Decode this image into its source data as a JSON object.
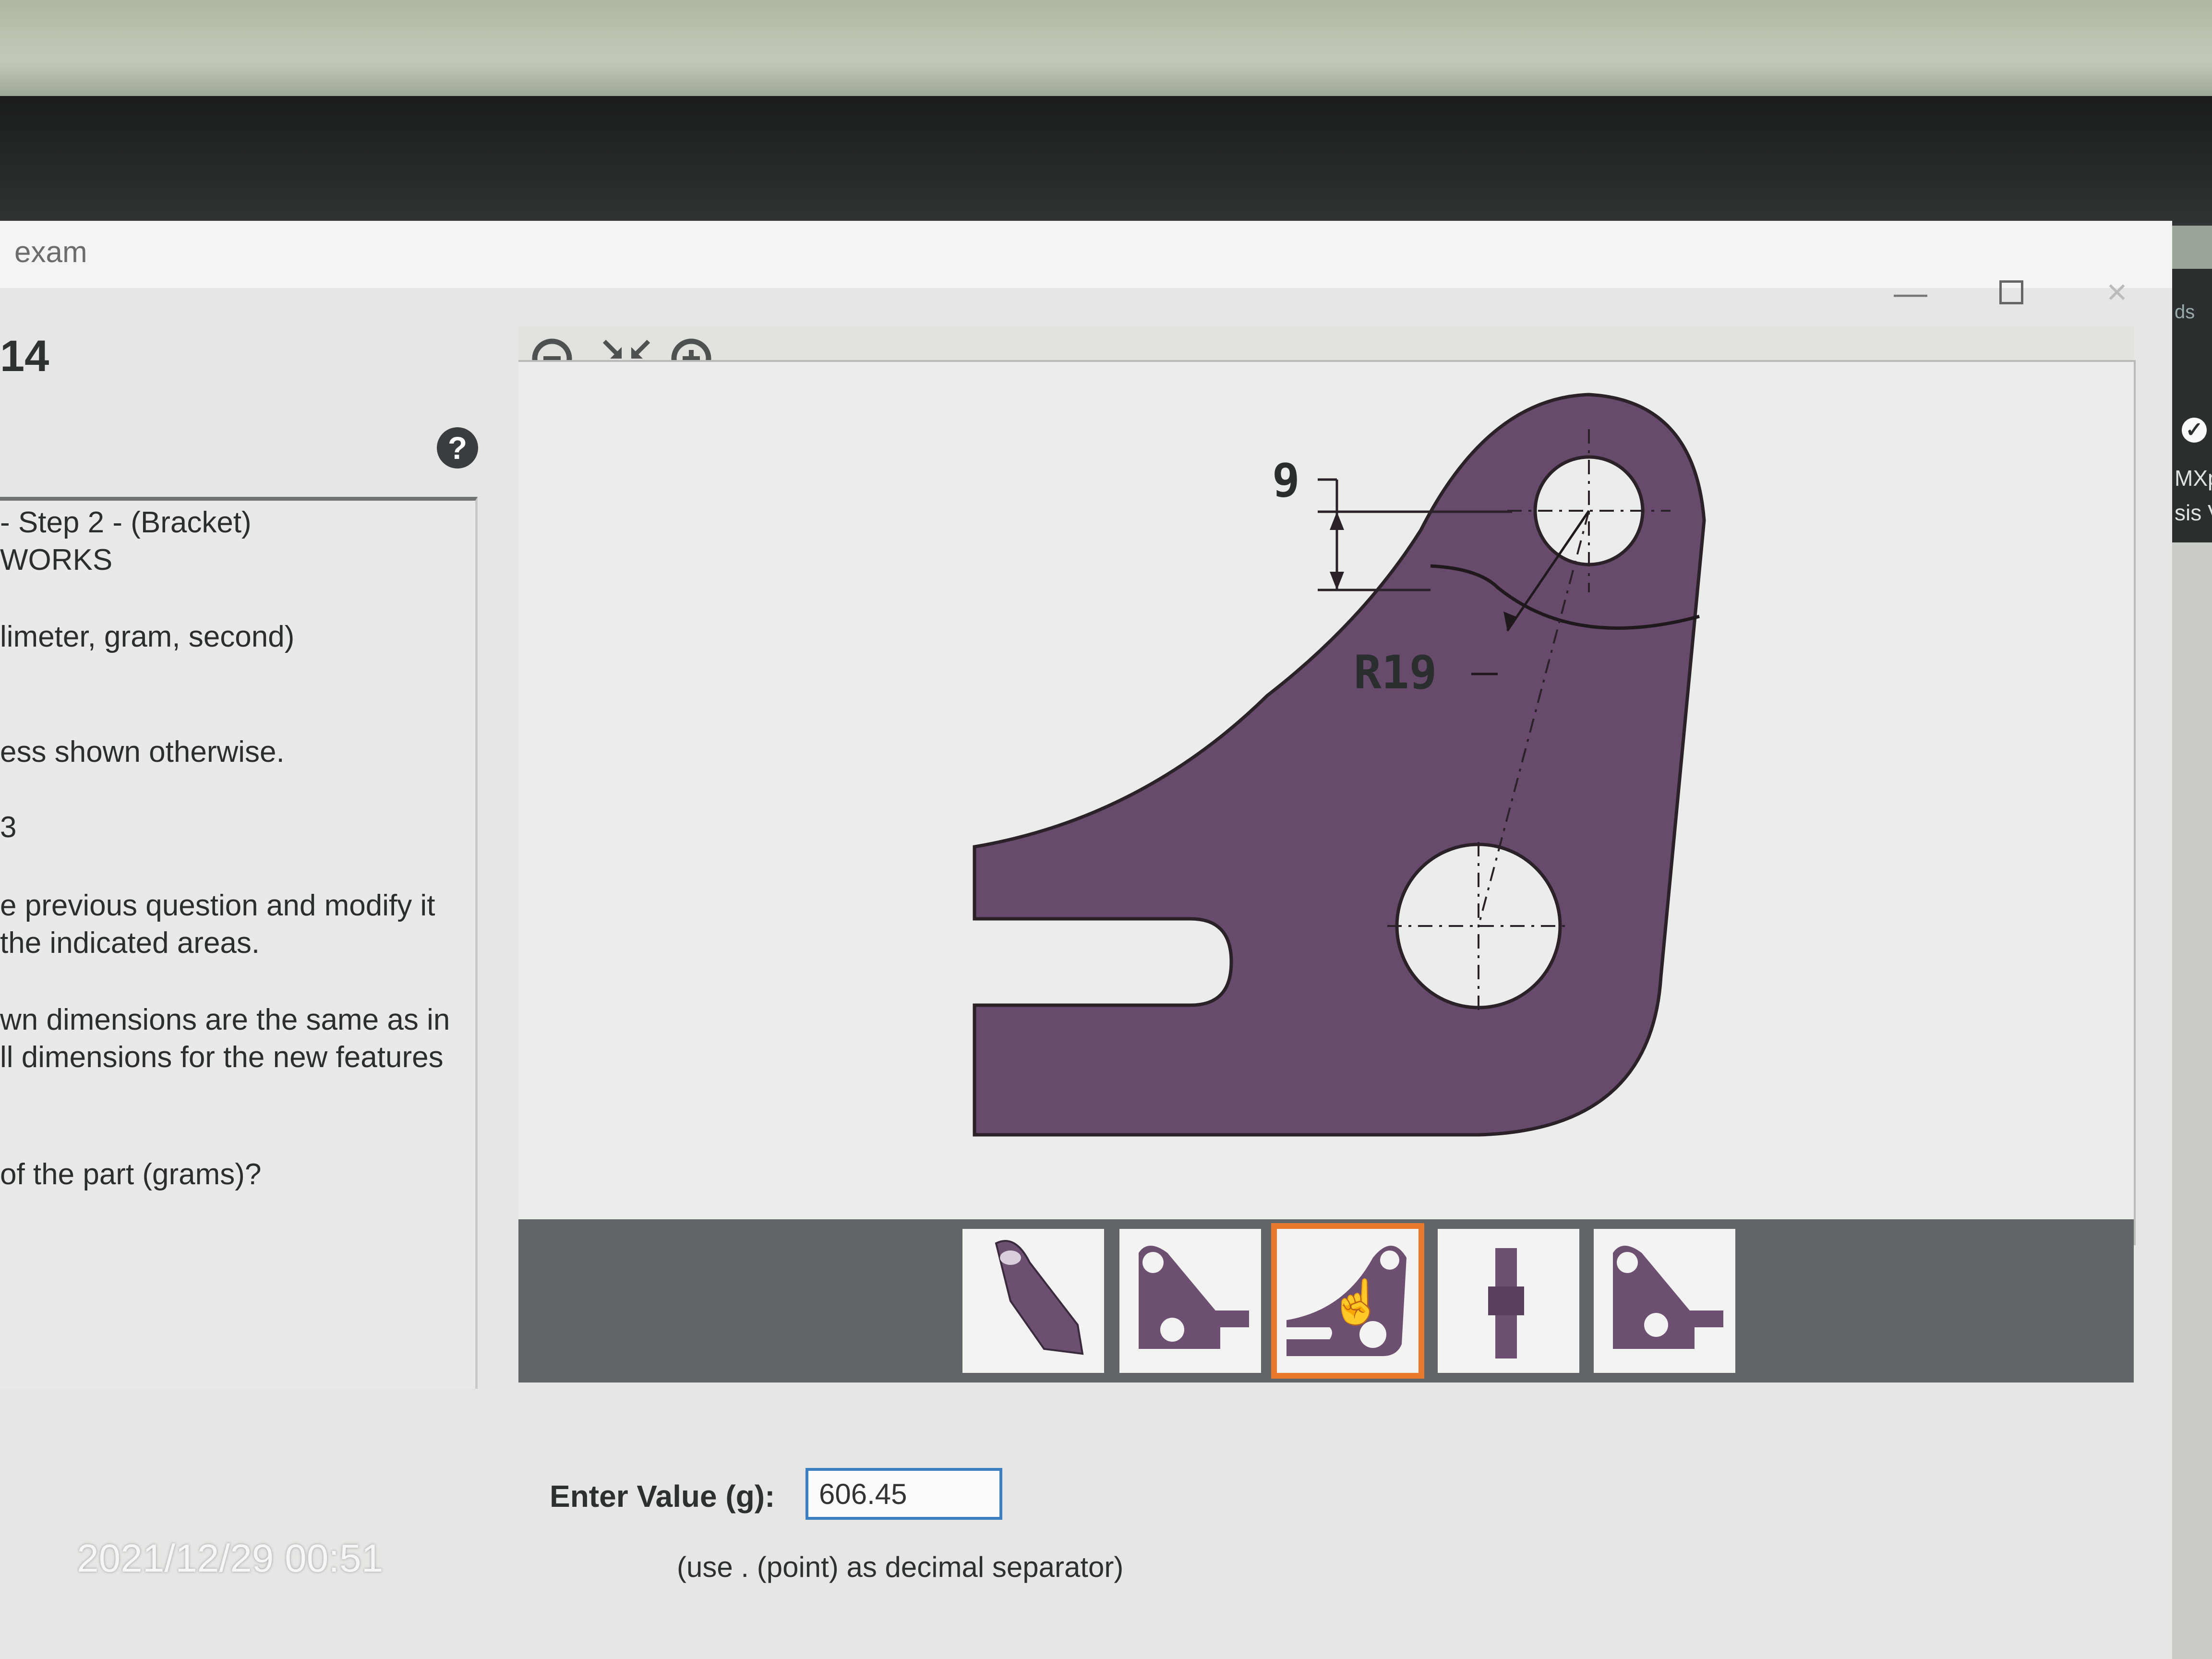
{
  "window": {
    "title": "exam",
    "controls": {
      "minimize": "—",
      "close": "✕"
    }
  },
  "question": {
    "number": "14",
    "help_label": "?",
    "lines": [
      "- Step 2 - (Bracket)",
      "WORKS",
      "limeter, gram, second)",
      "ess shown otherwise.",
      "3",
      "e previous question and modify it",
      "the indicated areas.",
      "wn dimensions are the same as in",
      "ll dimensions for the new features",
      "of the part (grams)?"
    ]
  },
  "drawing": {
    "dimension_top": "9",
    "radius_label": "R19",
    "part_color": "#684b6c"
  },
  "thumbnails": [
    {
      "name": "isometric-view",
      "selected": false
    },
    {
      "name": "front-view-dimensions",
      "selected": false
    },
    {
      "name": "front-view-modified",
      "selected": true
    },
    {
      "name": "side-view",
      "selected": false
    },
    {
      "name": "front-view-alt",
      "selected": false
    }
  ],
  "answer": {
    "label": "Enter Value (g):",
    "value": "606.45",
    "hint": "(use . (point) as decimal separator)"
  },
  "right_strip": {
    "line1": "ds",
    "line2": "MXp",
    "line3": "sis V"
  },
  "photo_timestamp": "2021/12/29 00:51",
  "accent_color": "#e97a2c"
}
